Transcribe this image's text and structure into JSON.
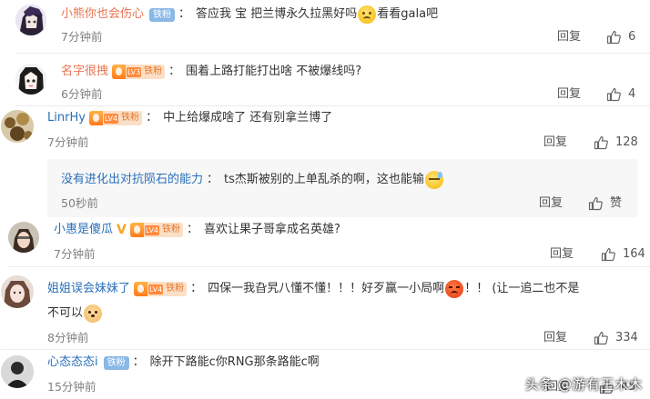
{
  "colors": {
    "username_orange": "#eb7350",
    "username_blue": "#2a6fb8",
    "time_grey": "#808080",
    "iron_badge": "#8ab8e6"
  },
  "comments": [
    {
      "username": "小熊你也会伤心",
      "badge": "铁粉",
      "text_a": "答应我 宝 把兰博永久拉黑好吗",
      "emoji_a": "sad-emoji",
      "text_b": " 看看gala吧",
      "time": "7分钟前",
      "reply": "回复",
      "likes": "6"
    },
    {
      "username": "名字很拽",
      "badge_level": "LV3",
      "badge": "铁粉",
      "text": "围着上路打能打出啥 不被爆线吗?",
      "time": "6分钟前",
      "reply": "回复",
      "likes": "4"
    },
    {
      "username": "LinrHy",
      "badge_level": "LV4",
      "badge": "铁粉",
      "text": "中上给爆成啥了 还有别拿兰博了",
      "time": "7分钟前",
      "reply": "回复",
      "likes": "128"
    },
    {
      "username": "没有进化出对抗陨石的能力",
      "text": "ts杰斯被别的上单乱杀的啊，这也能输",
      "emoji": "sweat-emoji",
      "time": "50秒前",
      "reply": "回复",
      "likes": "赞",
      "is_sub_reply": true
    },
    {
      "username": "小惠是傻瓜",
      "badge_level": "LV4",
      "badge": "铁粉",
      "text": "喜欢让果子哥拿成名英雄?",
      "time": "7分钟前",
      "reply": "回复",
      "likes": "164"
    },
    {
      "username": "姐姐误会妹妹了",
      "badge_level": "LV4",
      "badge": "铁粉",
      "text_a": "四保一我旮旯八懂不懂！！！好歹赢一小局啊",
      "emoji_a": "angry-emoji",
      "text_b": "！！  (让一追二也不是",
      "line2": "不可以",
      "emoji_b": "dog-emoji",
      "time": "8分钟前",
      "reply": "回复",
      "likes": "334"
    },
    {
      "username": "心态态态i",
      "badge": "铁粉",
      "text": "除开下路能c你RNG那条路能c啊",
      "time": "15分钟前",
      "reply": "回复",
      "likes": "45"
    }
  ],
  "watermark": {
    "text": "头条 @游有王木木"
  }
}
